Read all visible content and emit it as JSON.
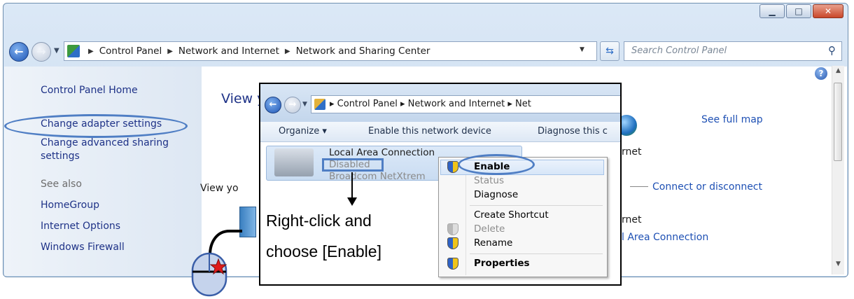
{
  "window": {
    "caption_buttons": {
      "minimize": "▁",
      "maximize": "□",
      "close": "✕"
    }
  },
  "nav": {
    "breadcrumb": [
      "Control Panel",
      "Network and Internet",
      "Network and Sharing Center"
    ],
    "search_placeholder": "Search Control Panel"
  },
  "sidebar": {
    "items": [
      {
        "label": "Control Panel Home"
      },
      {
        "label": "Change adapter settings"
      },
      {
        "label": "Change advanced sharing"
      },
      {
        "label": "settings"
      },
      {
        "label": "See also"
      },
      {
        "label": "HomeGroup"
      },
      {
        "label": "Internet Options"
      },
      {
        "label": "Windows Firewall"
      }
    ]
  },
  "main": {
    "heading_fragment": "View y",
    "view_fragment": "View yo",
    "see_full_map": "See full map",
    "internet_fragment": "rnet",
    "connect_or_disconnect": "Connect or disconnect",
    "internet_fragment_2": "rnet",
    "lan_link_fragment": "l Area Connection"
  },
  "inset": {
    "breadcrumb_text": "▸  Control Panel  ▸  Network and Internet  ▸  Net",
    "commands": [
      "Organize ▾",
      "Enable this network device",
      "Diagnose this c"
    ],
    "connection": {
      "name": "Local Area Connection",
      "status": "Disabled",
      "device": "Broadcom NetXtrem"
    },
    "instruction_line1": "Right-click and",
    "instruction_line2": "choose [Enable]"
  },
  "context_menu": {
    "items": [
      "Enable",
      "Status",
      "Diagnose",
      "Create Shortcut",
      "Delete",
      "Rename",
      "Properties"
    ]
  },
  "colors": {
    "annotation_blue": "#4f7ec4",
    "link_blue": "#1e3287",
    "star_red": "#e01b1b"
  },
  "icons": [
    "back-arrow-icon",
    "forward-arrow-icon",
    "control-panel-icon",
    "refresh-icon",
    "search-icon",
    "help-icon",
    "globe-icon",
    "shield-icon",
    "mouse-icon",
    "star-icon"
  ]
}
